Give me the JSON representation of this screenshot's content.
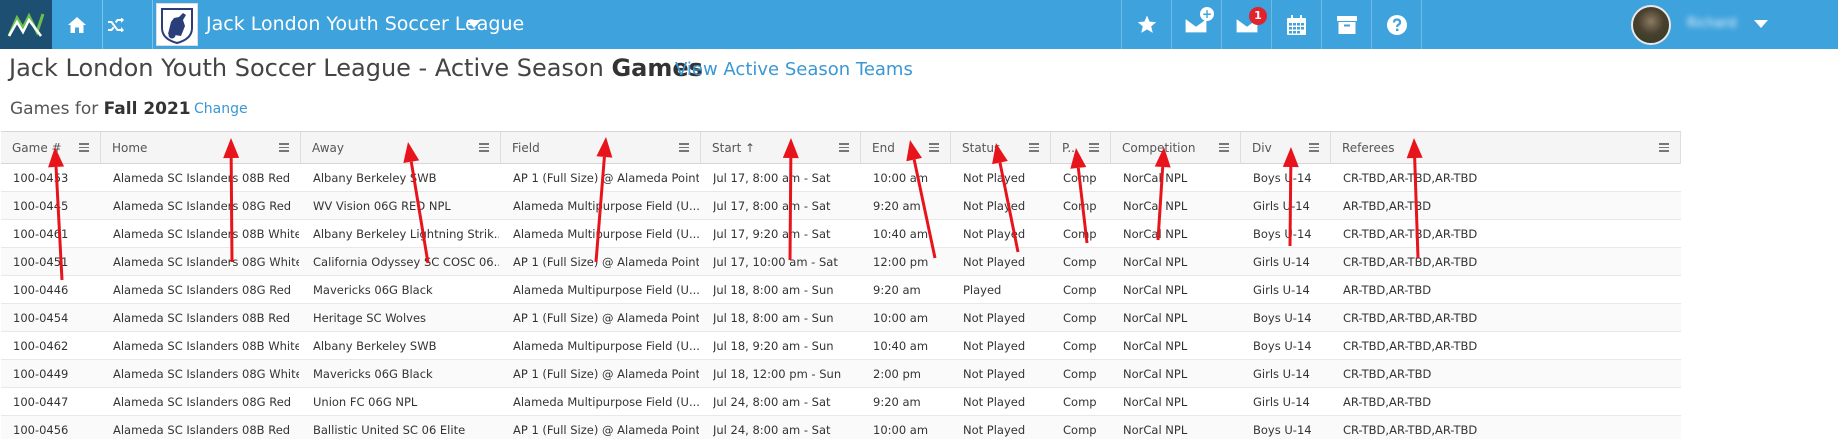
{
  "topbar": {
    "league_name": "Jack London Youth Soccer League",
    "user_name": "Richard",
    "unread_count": "1",
    "colors": {
      "bar": "#3ea2dd",
      "logo_bg": "#1d4f73",
      "badge": "#e0232d"
    }
  },
  "title": {
    "prefix": "Jack London Youth Soccer League - Active Season ",
    "strong": "Games",
    "view_link": "View Active Season Teams"
  },
  "season": {
    "prefix": "Games for ",
    "name": "Fall 2021",
    "change": "Change"
  },
  "columns": [
    "Game #",
    "Home",
    "Away",
    "Field",
    "Start",
    "End",
    "Status",
    "P...",
    "Competition",
    "Div",
    "Referees"
  ],
  "sort_indicator": "↑",
  "rows": [
    [
      "100-0453",
      "Alameda SC Islanders 08B Red",
      "Albany Berkeley SWB",
      "AP 1 (Full Size) @ Alameda Point",
      "Jul 17, 8:00 am - Sat",
      "10:00 am",
      "Not Played",
      "Comp",
      "NorCal NPL",
      "Boys U-14",
      "CR-TBD,AR-TBD,AR-TBD"
    ],
    [
      "100-0445",
      "Alameda SC Islanders 08G Red",
      "WV Vision 06G RED NPL",
      "Alameda Multipurpose Field (U...",
      "Jul 17, 8:00 am - Sat",
      "9:20 am",
      "Not Played",
      "Comp",
      "NorCal NPL",
      "Girls U-14",
      "AR-TBD,AR-TBD"
    ],
    [
      "100-0461",
      "Alameda SC Islanders 08B White",
      "Albany Berkeley Lightning Strik...",
      "Alameda Multipurpose Field (U...",
      "Jul 17, 9:20 am - Sat",
      "10:40 am",
      "Not Played",
      "Comp",
      "NorCal NPL",
      "Boys U-14",
      "CR-TBD,AR-TBD,AR-TBD"
    ],
    [
      "100-0451",
      "Alameda SC Islanders 08G White",
      "California Odyssey SC COSC 06...",
      "AP 1 (Full Size) @ Alameda Point",
      "Jul 17, 10:00 am - Sat",
      "12:00 pm",
      "Not Played",
      "Comp",
      "NorCal NPL",
      "Girls U-14",
      "CR-TBD,AR-TBD,AR-TBD"
    ],
    [
      "100-0446",
      "Alameda SC Islanders 08G Red",
      "Mavericks 06G Black",
      "Alameda Multipurpose Field (U...",
      "Jul 18, 8:00 am - Sun",
      "9:20 am",
      "Played",
      "Comp",
      "NorCal NPL",
      "Girls U-14",
      "AR-TBD,AR-TBD"
    ],
    [
      "100-0454",
      "Alameda SC Islanders 08B Red",
      "Heritage SC Wolves",
      "AP 1 (Full Size) @ Alameda Point",
      "Jul 18, 8:00 am - Sun",
      "10:00 am",
      "Not Played",
      "Comp",
      "NorCal NPL",
      "Boys U-14",
      "CR-TBD,AR-TBD,AR-TBD"
    ],
    [
      "100-0462",
      "Alameda SC Islanders 08B White",
      "Albany Berkeley SWB",
      "Alameda Multipurpose Field (U...",
      "Jul 18, 9:20 am - Sun",
      "10:40 am",
      "Not Played",
      "Comp",
      "NorCal NPL",
      "Boys U-14",
      "CR-TBD,AR-TBD,AR-TBD"
    ],
    [
      "100-0449",
      "Alameda SC Islanders 08G White",
      "Mavericks 06G Black",
      "AP 1 (Full Size) @ Alameda Point",
      "Jul 18, 12:00 pm - Sun",
      "2:00 pm",
      "Not Played",
      "Comp",
      "NorCal NPL",
      "Girls U-14",
      "CR-TBD,AR-TBD"
    ],
    [
      "100-0447",
      "Alameda SC Islanders 08G Red",
      "Union FC 06G NPL",
      "Alameda Multipurpose Field (U...",
      "Jul 24, 8:00 am - Sat",
      "9:20 am",
      "Not Played",
      "Comp",
      "NorCal NPL",
      "Girls U-14",
      "AR-TBD,AR-TBD"
    ],
    [
      "100-0456",
      "Alameda SC Islanders 08B Red",
      "Ballistic United SC 06 Elite",
      "AP 1 (Full Size) @ Alameda Point",
      "Jul 24, 8:00 am - Sat",
      "10:00 am",
      "Not Played",
      "Comp",
      "NorCal NPL",
      "Boys U-14",
      "CR-TBD,AR-TBD,AR-TBD"
    ]
  ],
  "annotation_color": "#e8141c"
}
